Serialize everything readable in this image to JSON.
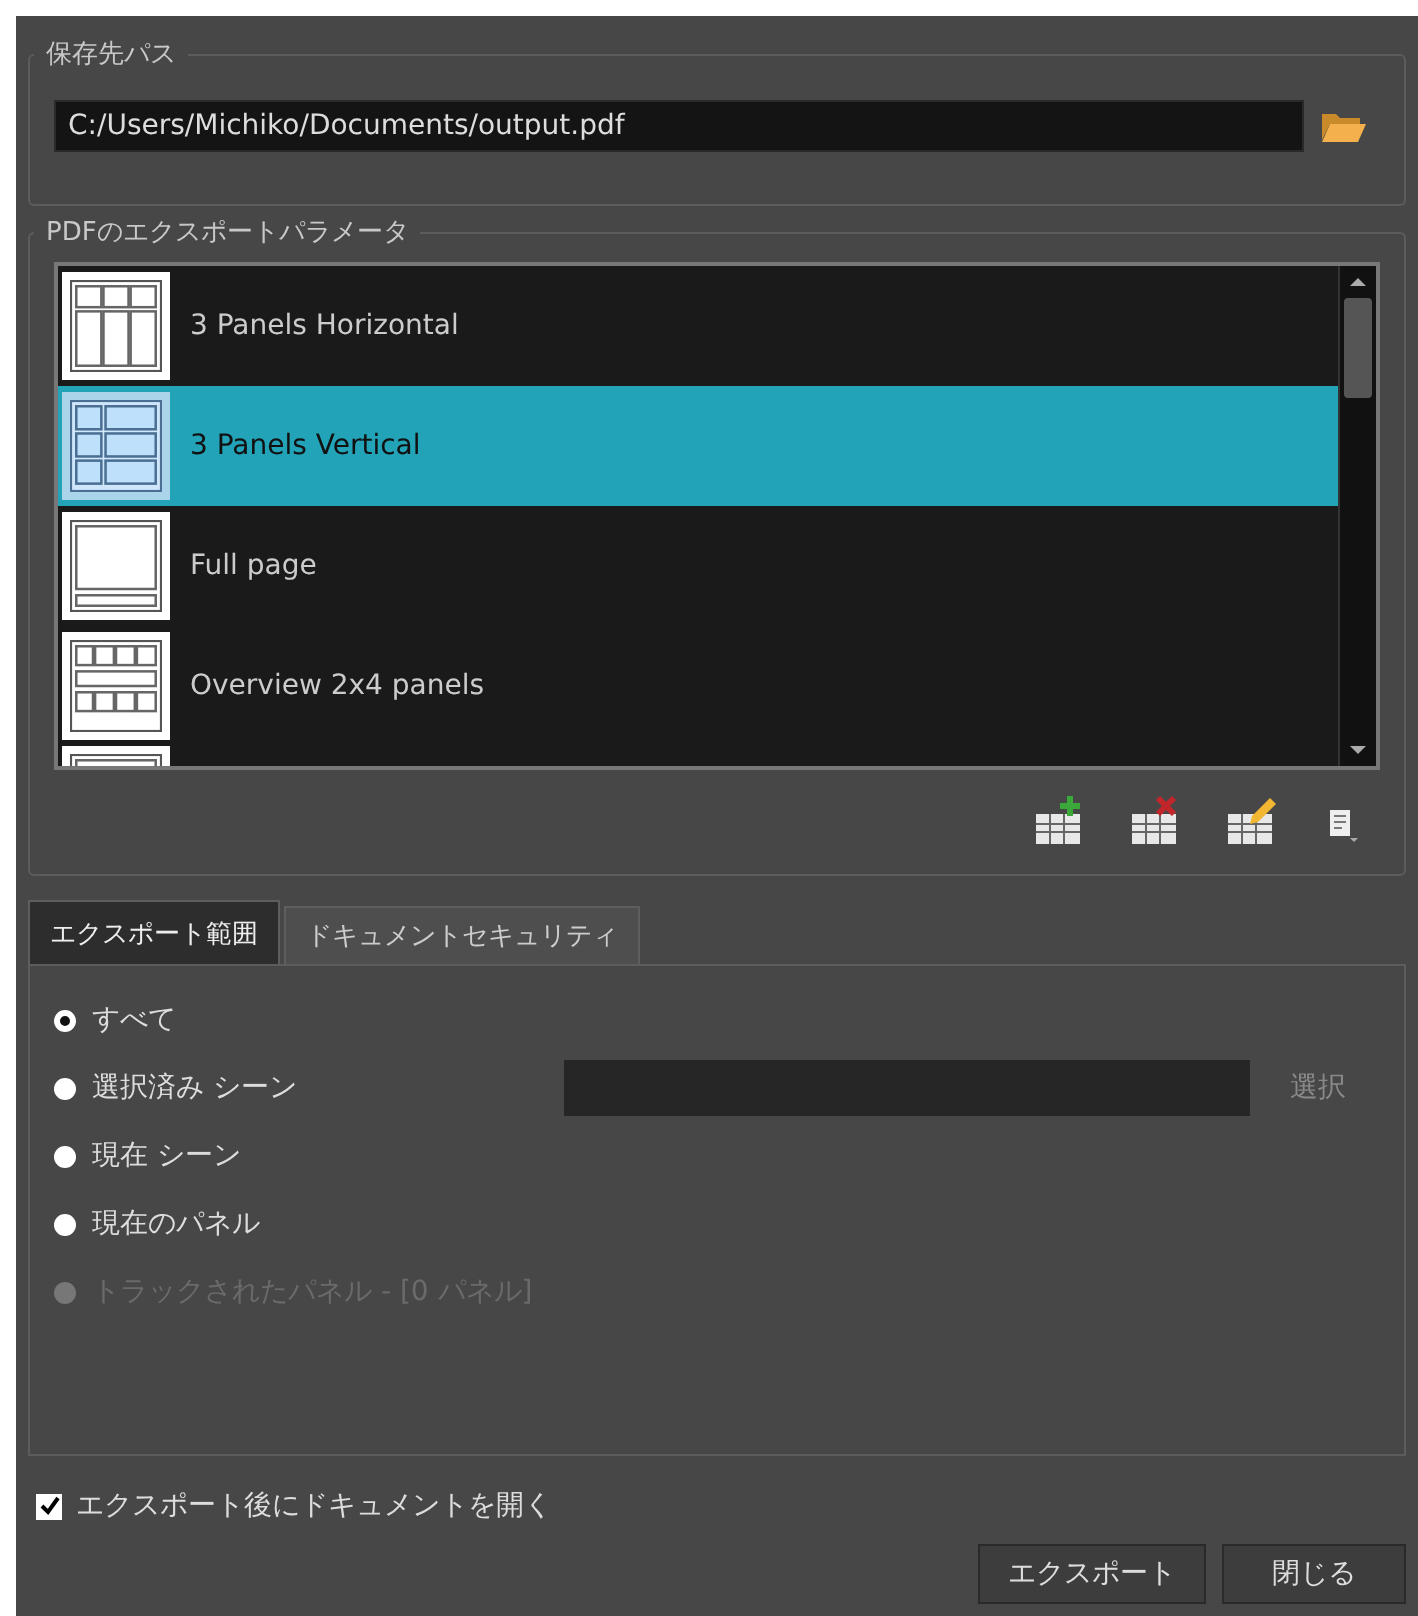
{
  "path_group": {
    "title": "保存先パス",
    "path": "C:/Users/Michiko/Documents/output.pdf"
  },
  "params_group": {
    "title": "PDFのエクスポートパラメータ",
    "presets": [
      {
        "kind": "three-horizontal",
        "label": "3 Panels Horizontal",
        "selected": false
      },
      {
        "kind": "three-vertical",
        "label": "3 Panels Vertical",
        "selected": true
      },
      {
        "kind": "full",
        "label": "Full page",
        "selected": false
      },
      {
        "kind": "overview",
        "label": "Overview 2x4 panels",
        "selected": false
      },
      {
        "kind": "partial",
        "selected": false
      }
    ],
    "tools": [
      {
        "kind": "add"
      },
      {
        "kind": "delete"
      },
      {
        "kind": "edit"
      },
      {
        "kind": "menu"
      }
    ]
  },
  "tabs": [
    {
      "label": "エクスポート範囲",
      "selected": true
    },
    {
      "label": "ドキュメントセキュリティ",
      "selected": false
    }
  ],
  "range_options": [
    {
      "label": "すべて",
      "selected": true,
      "disabled": false
    },
    {
      "label": "選択済み シーン",
      "selected": false,
      "disabled": false,
      "picker_button": "選択",
      "picker_disabled": true
    },
    {
      "label": "現在 シーン",
      "selected": false,
      "disabled": false
    },
    {
      "label": "現在のパネル",
      "selected": false,
      "disabled": false
    },
    {
      "label": "トラックされたパネル - [0 パネル]",
      "selected": false,
      "disabled": true
    }
  ],
  "open_after": {
    "label": "エクスポート後にドキュメントを開く",
    "checked": true
  },
  "buttons": [
    "エクスポート",
    "閉じる"
  ]
}
